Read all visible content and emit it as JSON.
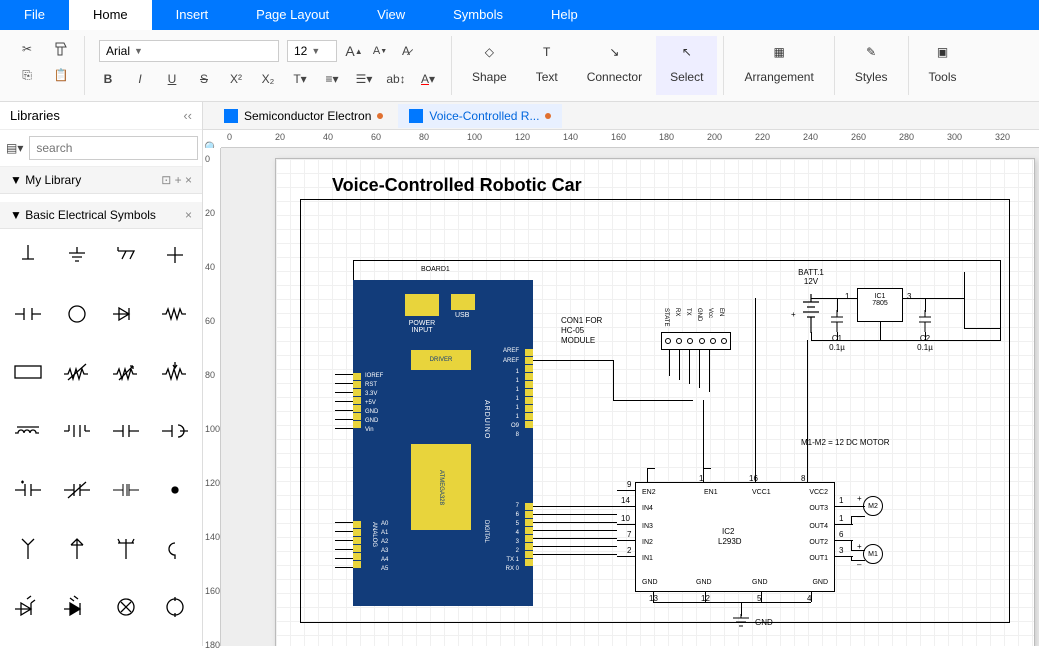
{
  "menu": {
    "file": "File",
    "home": "Home",
    "insert": "Insert",
    "page_layout": "Page Layout",
    "view": "View",
    "symbols": "Symbols",
    "help": "Help"
  },
  "toolbar": {
    "font": "Arial",
    "size": "12",
    "shape": "Shape",
    "text": "Text",
    "connector": "Connector",
    "select": "Select",
    "arrangement": "Arrangement",
    "styles": "Styles",
    "tools": "Tools"
  },
  "libraries": {
    "title": "Libraries",
    "search_placeholder": "search",
    "my_library": "My Library",
    "basic": "Basic Electrical Symbols"
  },
  "doc_tabs": {
    "t1": "Semiconductor Electron",
    "t2": "Voice-Controlled R..."
  },
  "ruler_h": [
    "0",
    "20",
    "40",
    "60",
    "80",
    "100",
    "120",
    "140",
    "160",
    "180",
    "200",
    "220",
    "240",
    "260",
    "280",
    "300",
    "320"
  ],
  "ruler_v": [
    "0",
    "20",
    "40",
    "60",
    "80",
    "100",
    "120",
    "140",
    "160",
    "180"
  ],
  "diagram": {
    "title": "Voice-Controlled Robotic Car",
    "board_label": "BOARD1",
    "power_input": "POWER INPUT",
    "usb": "USB",
    "driver": "DRIVER",
    "atmega": "ATMEGA328",
    "pins_left": [
      "IOREF",
      "RST",
      "3.3V",
      "+5V",
      "GND",
      "GND",
      "Vin"
    ],
    "analog": "ANALOG",
    "analog_pins": [
      "A0",
      "A1",
      "A2",
      "A3",
      "A4",
      "A5"
    ],
    "arduino": "ARDUINO",
    "digital": "DIGITAL",
    "aref1": "AREF",
    "aref2": "AREF",
    "dig_right": [
      "1",
      "1",
      "1",
      "1",
      "1",
      "1",
      "O9",
      "8"
    ],
    "dig_right2": [
      "7",
      "6",
      "5",
      "4",
      "3",
      "2",
      "TX 1",
      "RX 0"
    ],
    "con1_label": "CON1 FOR HC-05 MODULE",
    "con1_pins": [
      "STATE",
      "RX",
      "TX",
      "GND",
      "Vcc",
      "EN"
    ],
    "batt": "BATT.1",
    "batt_v": "12V",
    "ic1": "IC1",
    "ic1_p": "7805",
    "ic1_1": "1",
    "ic1_3": "3",
    "c1": "C1",
    "c1_v": "0.1µ",
    "c2": "C2",
    "c2_v": "0.1µ",
    "motors_label": "M1-M2 = 12 DC MOTOR",
    "ic2": "IC2",
    "ic2_p": "L293D",
    "ic2_pins": {
      "en2": "EN2",
      "in4": "IN4",
      "in3": "IN3",
      "in2": "IN2",
      "in1": "IN1",
      "en1": "EN1",
      "vcc1": "VCC1",
      "vcc2": "VCC2",
      "out3": "OUT3",
      "out4": "OUT4",
      "out2": "OUT2",
      "out1": "OUT1",
      "gnd": "GND"
    },
    "ic2_nums": {
      "p9": "9",
      "p14": "14",
      "p10": "10",
      "p7": "7",
      "p2": "2",
      "p1": "1",
      "p16": "16",
      "p8": "8",
      "p11": "1",
      "p13b": "1",
      "p6": "6",
      "p3": "3",
      "p13": "13",
      "p12": "12",
      "p5": "5",
      "p4": "4"
    },
    "m1": "M1",
    "m2": "M2",
    "gnd": "GND",
    "plus": "+",
    "minus": "–"
  }
}
